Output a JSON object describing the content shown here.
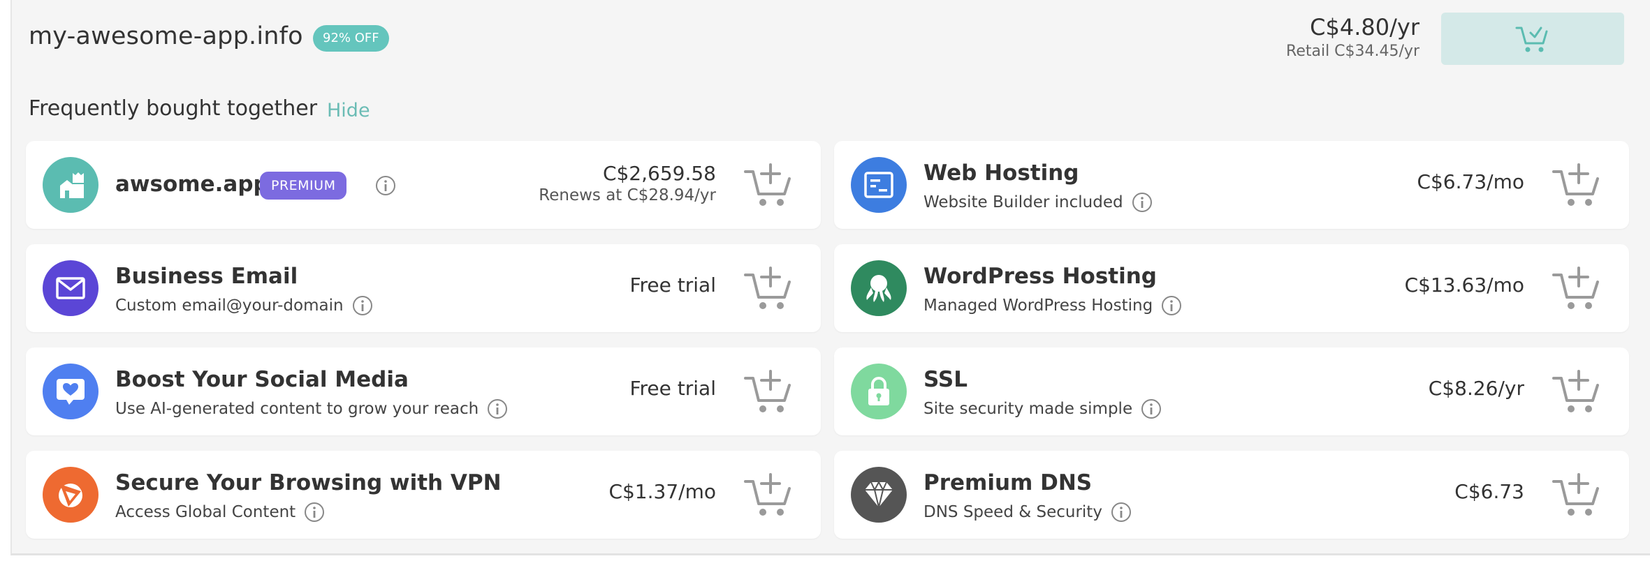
{
  "domain": {
    "name": "my-awesome-app.info",
    "discount": "92% OFF",
    "price": "C$4.80/yr",
    "retail": "Retail C$34.45/yr"
  },
  "fbt": {
    "title": "Frequently bought together",
    "hide": "Hide"
  },
  "products": {
    "app": {
      "name": "awsome.app",
      "badge": "PREMIUM",
      "price": "C$2,659.58",
      "renew": "Renews at C$28.94/yr"
    },
    "web_hosting": {
      "name": "Web Hosting",
      "subtitle": "Website Builder included",
      "price": "C$6.73/mo"
    },
    "email": {
      "name": "Business Email",
      "subtitle": "Custom email@your-domain",
      "price": "Free trial"
    },
    "wordpress": {
      "name": "WordPress Hosting",
      "subtitle": "Managed WordPress Hosting",
      "price": "C$13.63/mo"
    },
    "social": {
      "name": "Boost Your Social Media",
      "subtitle": "Use AI-generated content to grow your reach",
      "price": "Free trial"
    },
    "ssl": {
      "name": "SSL",
      "subtitle": "Site security made simple",
      "price": "C$8.26/yr"
    },
    "vpn": {
      "name": "Secure Your Browsing with VPN",
      "subtitle": "Access Global Content",
      "price": "C$1.37/mo"
    },
    "dns": {
      "name": "Premium DNS",
      "subtitle": "DNS Speed & Security",
      "price": "C$6.73"
    }
  },
  "colors": {
    "teal": "#5bbcb1",
    "blue": "#3d7de0",
    "purple": "#5b46d6",
    "green": "#2f8a5f",
    "social": "#4f7ff0",
    "ssl": "#7fd99e",
    "vpn": "#ee6a31",
    "dns": "#555555",
    "premium": "#7c6be0"
  }
}
